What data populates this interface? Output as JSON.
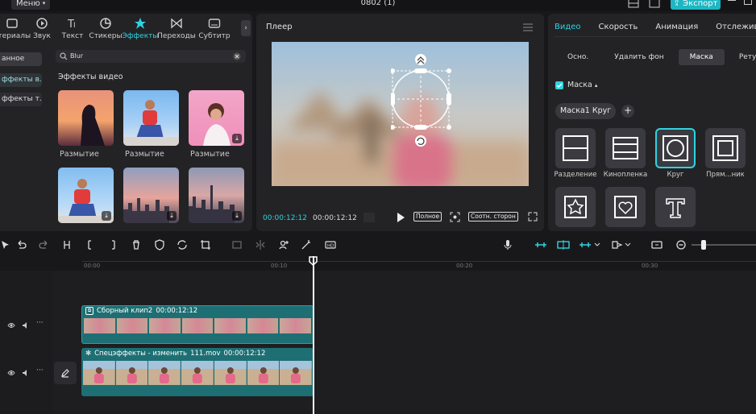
{
  "titlebar": {
    "menu_label": "Меню",
    "project_name": "0802 (1)",
    "export_label": "Экспорт"
  },
  "categories": [
    {
      "label": "атериалы",
      "icon": "materials-icon"
    },
    {
      "label": "Звук",
      "icon": "audio-icon"
    },
    {
      "label": "Текст",
      "icon": "text-icon"
    },
    {
      "label": "Стикеры",
      "icon": "sticker-icon"
    },
    {
      "label": "Эффекты",
      "icon": "effects-icon",
      "active": true
    },
    {
      "label": "Переходы",
      "icon": "transition-icon"
    },
    {
      "label": "Субтитр",
      "icon": "subtitle-icon"
    }
  ],
  "side_nav": [
    "анное",
    "ффекты в...",
    "ффекты т..."
  ],
  "search": {
    "value": "Blur"
  },
  "effects": {
    "section_title": "Эффекты видео",
    "items": [
      {
        "label": "Размытие"
      },
      {
        "label": "Размытие"
      },
      {
        "label": "Размытие"
      },
      {
        "label": ""
      },
      {
        "label": ""
      },
      {
        "label": ""
      }
    ]
  },
  "player": {
    "title": "Плеер",
    "time_current": "00:00:12:12",
    "time_total": "00:00:12:12",
    "fullscreen_label": "Полное",
    "ratio_label": "Соотн. сторон"
  },
  "props": {
    "tabs": [
      "Видео",
      "Скорость",
      "Анимация",
      "Отслеживани"
    ],
    "sub_tabs": [
      "Осно.",
      "Удалить фон",
      "Маска",
      "Ретуш"
    ],
    "mask_label": "Маска",
    "mask_chip": "Маска1 Круг",
    "mask_options": [
      {
        "label": "Разделение",
        "icon": "split-mask-icon"
      },
      {
        "label": "Кинопленка",
        "icon": "filmstrip-mask-icon"
      },
      {
        "label": "Круг",
        "icon": "circle-mask-icon",
        "selected": true
      },
      {
        "label": "Прям...ник",
        "icon": "rectangle-mask-icon"
      },
      {
        "label": "",
        "icon": "star-mask-icon"
      },
      {
        "label": "",
        "icon": "heart-mask-icon"
      },
      {
        "label": "",
        "icon": "text-mask-icon"
      }
    ]
  },
  "timeline": {
    "ticks": [
      "00:00",
      "00:10",
      "00:20",
      "00:30"
    ],
    "clip1": {
      "title": "Сборный клип2",
      "duration": "00:00:12:12"
    },
    "clip2": {
      "title": "Спецэффекты - изменить",
      "file": "111.mov",
      "duration": "00:00:12:12"
    }
  },
  "colors": {
    "accent": "#2fd3e0",
    "clip": "#1d6f73",
    "bg": "#18181a",
    "panel": "#232326"
  }
}
